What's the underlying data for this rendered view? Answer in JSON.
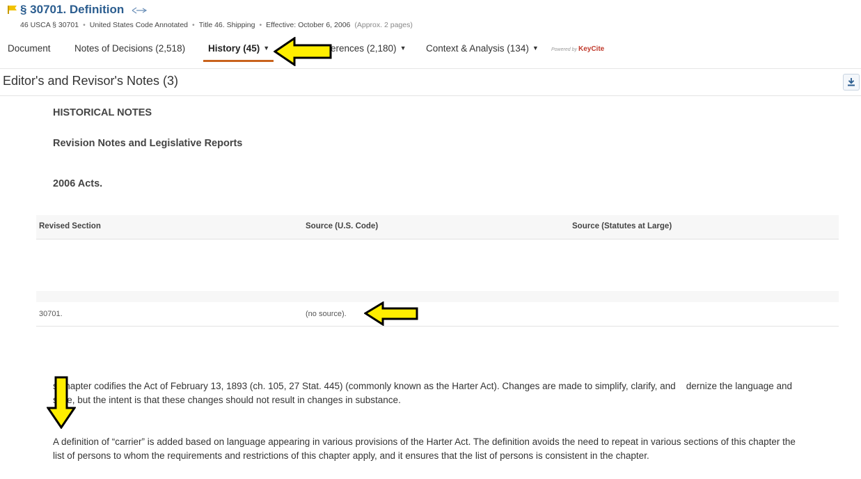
{
  "header": {
    "title": "§ 30701. Definition",
    "meta": {
      "citation": "46 USCA § 30701",
      "source": "United States Code Annotated",
      "title_ref": "Title 46. Shipping",
      "effective": "Effective: October 6, 2006",
      "pages": "(Approx. 2 pages)"
    }
  },
  "tabs": [
    {
      "label": "Document"
    },
    {
      "label": "Notes of Decisions (2,518)"
    },
    {
      "label": "History (45)"
    },
    {
      "label": "erences (2,180)"
    },
    {
      "label": "Context & Analysis (134)"
    }
  ],
  "powered_by": {
    "prefix": "Powered by",
    "brand": "KeyCite"
  },
  "section": {
    "title": "Editor's and Revisor's Notes (3)"
  },
  "content": {
    "historical_notes": "HISTORICAL NOTES",
    "revision_notes": "Revision Notes and Legislative Reports",
    "acts": "2006 Acts.",
    "table": {
      "headers": [
        "Revised Section",
        "Source (U.S. Code)",
        "Source (Statutes at Large)"
      ],
      "rows": [
        [
          "30701.",
          "(no source).",
          ""
        ]
      ]
    },
    "paragraphs": [
      "s chapter codifies the Act of February 13, 1893 (ch. 105, 27 Stat. 445) (commonly known as the Harter Act).   Changes are made to simplify, clarify, and    dernize the language and style, but the intent is that these changes should not result in changes in substance.",
      "A definition of “carrier” is added based on language appearing in various provisions of the Harter Act.   The definition avoids the need to repeat in various sections of this chapter the list of persons to whom the requirements and restrictions of this chapter apply, and it ensures that the list of persons is consistent in the chapter."
    ]
  },
  "colors": {
    "title": "#2b5d8f",
    "tab_underline": "#c9631d",
    "flag": "#e8b500",
    "annotation_arrow": "#ffee00"
  }
}
